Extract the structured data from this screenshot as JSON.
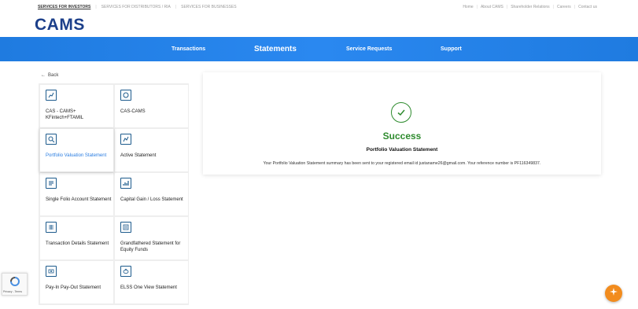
{
  "topbar": {
    "left_links": [
      "SERVICES FOR INVESTORS",
      "SERVICES FOR DISTRIBUTORS / RIA",
      "SERVICES FOR BUSINESSES"
    ],
    "right_links": [
      "Home",
      "About CAMS",
      "Shareholder Relations",
      "Careers",
      "Contact us"
    ]
  },
  "logo": {
    "text": "CAMS"
  },
  "navbar": {
    "items": [
      "Transactions",
      "Statements",
      "Service Requests",
      "Support"
    ],
    "active": "Statements",
    "color": "#1f7be0"
  },
  "back": {
    "label": "Back"
  },
  "statements": [
    {
      "label": "CAS - CAMS+ KFintech+FTAMIL",
      "icon": "document-chart-icon"
    },
    {
      "label": "CAS-CAMS",
      "icon": "document-shield-icon"
    },
    {
      "label": "Portfolio Valuation Statement",
      "icon": "document-search-icon",
      "selected": true
    },
    {
      "label": "Active Statement",
      "icon": "document-chart-icon"
    },
    {
      "label": "Single Folio Account Statement",
      "icon": "document-lines-icon"
    },
    {
      "label": "Capital Gain / Loss Statement",
      "icon": "bar-chart-icon"
    },
    {
      "label": "Transaction Details Statement",
      "icon": "document-grid-icon"
    },
    {
      "label": "Grandfathered Statement for Equity Funds",
      "icon": "document-list-icon"
    },
    {
      "label": "Pay-In Pay-Out Statement",
      "icon": "document-money-icon"
    },
    {
      "label": "ELSS One View Statement",
      "icon": "piggy-bank-icon"
    }
  ],
  "result": {
    "status": "Success",
    "title": "Portfolio Valuation Statement",
    "message": "Your Portfolio Valuation Statement summary has been sent to your registered email id justaname26@gmail.com. Your reference number is PF116349837.",
    "color": "#2e8b2e"
  },
  "recaptcha": {
    "text": "Privacy - Terms"
  },
  "accent_color": "#2a7de1"
}
